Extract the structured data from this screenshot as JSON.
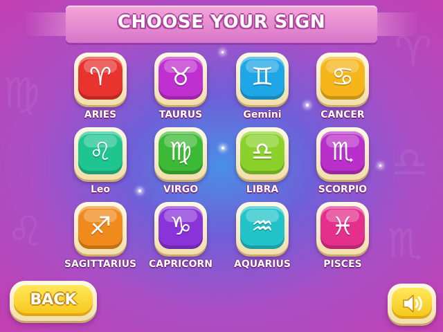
{
  "title": "CHOOSE YOUR SIGN",
  "signs": [
    {
      "label": "ARIES",
      "icon": "aries-icon",
      "glyph": "♈",
      "color": "#e8332f"
    },
    {
      "label": "TAURUS",
      "icon": "taurus-icon",
      "glyph": "♉",
      "color": "#c02fd0"
    },
    {
      "label": "Gemini",
      "icon": "gemini-icon",
      "glyph": "♊",
      "color": "#1fa6e6"
    },
    {
      "label": "CANCER",
      "icon": "cancer-icon",
      "glyph": "♋",
      "color": "#f6b51a"
    },
    {
      "label": "Leo",
      "icon": "leo-icon",
      "glyph": "♌",
      "color": "#1fc58f"
    },
    {
      "label": "VIRGO",
      "icon": "virgo-icon",
      "glyph": "♍",
      "color": "#3cb935"
    },
    {
      "label": "LIBRA",
      "icon": "libra-icon",
      "glyph": "♎",
      "color": "#8bd12c"
    },
    {
      "label": "SCORPIO",
      "icon": "scorpio-icon",
      "glyph": "♏",
      "color": "#b92fc9"
    },
    {
      "label": "SAGITTARIUS",
      "icon": "sagittarius-icon",
      "glyph": "♐",
      "color": "#f08a1c"
    },
    {
      "label": "CAPRICORN",
      "icon": "capricorn-icon",
      "glyph": "♑",
      "color": "#8a33d8"
    },
    {
      "label": "AQUARIUS",
      "icon": "aquarius-icon",
      "glyph": "♒",
      "color": "#23c3c9"
    },
    {
      "label": "PISCES",
      "icon": "pisces-icon",
      "glyph": "♓",
      "color": "#e42f8c"
    }
  ],
  "back_label": "BACK",
  "sound_icon": "speaker-icon",
  "colors": {
    "button_yellow": "#f6c518",
    "title_pink": "#d875c9"
  }
}
